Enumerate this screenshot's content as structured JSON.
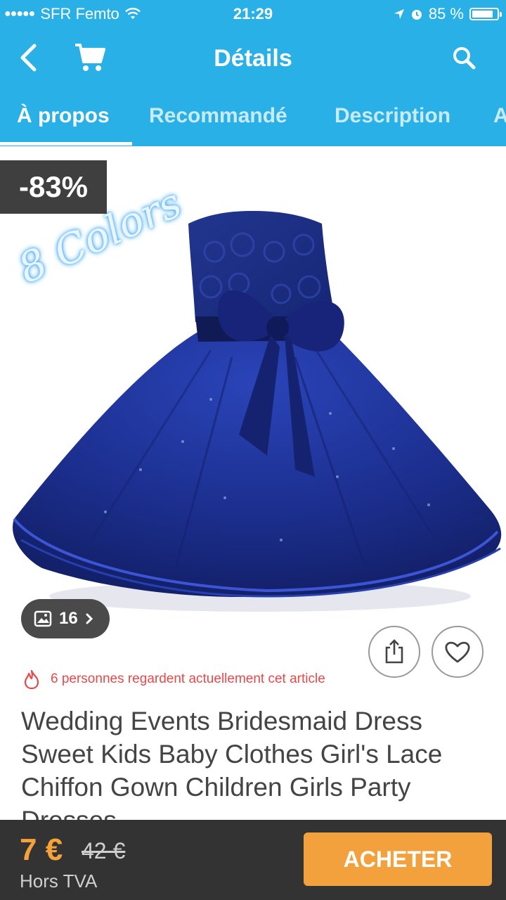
{
  "status_bar": {
    "carrier": "SFR Femto",
    "time": "21:29",
    "battery_percent": "85 %",
    "battery_level": 0.85
  },
  "nav": {
    "title": "Détails",
    "back_icon": "back-chevron-icon",
    "cart_icon": "cart-icon",
    "search_icon": "search-icon"
  },
  "tabs": [
    {
      "label": "À propos",
      "active": true
    },
    {
      "label": "Recommandé",
      "active": false
    },
    {
      "label": "Description",
      "active": false
    },
    {
      "label": "A",
      "active": false
    }
  ],
  "product": {
    "discount": "-83%",
    "watermark": "8 Colors",
    "gallery_count": "16",
    "watchers_text": "6 personnes regardent actuellement cet article",
    "title": "Wedding Events Bridesmaid Dress Sweet Kids Baby Clothes Girl's Lace Chiffon Gown Children Girls Party Dresses"
  },
  "purchase": {
    "price": "7 €",
    "old_price": "42 €",
    "tax_note": "Hors TVA",
    "buy_label": "ACHETER"
  },
  "colors": {
    "header": "#29b0e6",
    "dress": "#1c2f8f",
    "buy_button": "#f2a13c",
    "price": "#f5a23a",
    "bottom_bar": "#333333"
  }
}
